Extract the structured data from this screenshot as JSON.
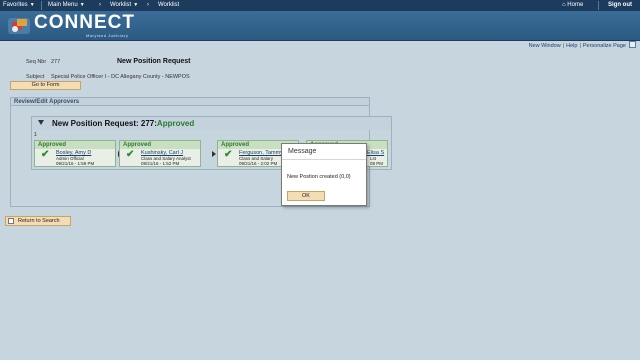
{
  "nav": {
    "favorites": "Favorites",
    "main_menu": "Main Menu",
    "breadcrumb_1": "Worklist",
    "breadcrumb_2": "Worklist",
    "home": "Home",
    "sign_out": "Sign out"
  },
  "brand": {
    "name": "CONNECT",
    "tagline": "Maryland Judiciary"
  },
  "page_links": {
    "new_window": "New Window",
    "help": "Help",
    "personalize": "Personalize Page"
  },
  "form": {
    "seq_label": "Seq Nbr",
    "seq_value": "277",
    "title": "New Position Request",
    "subject_label": "Subject",
    "subject_value": "Special Police Officer I - DC Allegany County - NEWPOS",
    "go_to_form": "Go to Form"
  },
  "section": {
    "title": "Review/Edit Approvers",
    "panel_title": "New Position Request: 277:",
    "panel_status": "Approved",
    "row_number": "1"
  },
  "approvers": [
    {
      "status": "Approved",
      "name": "Bosley, Amy D",
      "role": "Admin Official",
      "date": "09/21/16 - 1:59 PM"
    },
    {
      "status": "Approved",
      "name": "Kushinsky, Carl J",
      "role": "Class and Salary Analyst",
      "date": "09/21/16 - 1:52 PM"
    },
    {
      "status": "Approved",
      "name": "Ferguson, Tammy",
      "role": "Class and Salary",
      "date": "09/21/16 - 2:02 PM"
    },
    {
      "status": "Approved",
      "name": "Elisa S",
      "role": "Lst",
      "date": "08 PM"
    }
  ],
  "modal": {
    "title": "Message",
    "body": "New Postion created (0,0)",
    "ok": "OK"
  },
  "return_button": "Return to Search"
}
